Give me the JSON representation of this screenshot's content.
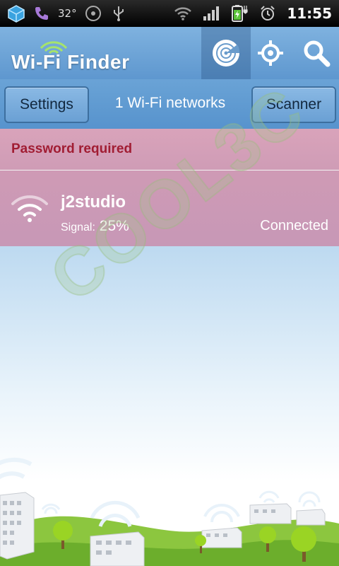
{
  "status_bar": {
    "temperature": "32°",
    "time": "11:55",
    "icons": [
      "cube-app-icon",
      "phone-icon",
      "media-icon",
      "usb-icon",
      "wifi-signal-icon",
      "cell-signal-icon",
      "battery-charging-icon",
      "alarm-icon"
    ]
  },
  "app": {
    "title": "Wi-Fi Finder",
    "header_actions": [
      "radar-icon",
      "locate-icon",
      "search-icon"
    ]
  },
  "toolbar": {
    "settings_label": "Settings",
    "network_count": "1 Wi-Fi networks",
    "scanner_label": "Scanner"
  },
  "networks": {
    "section_title": "Password required",
    "items": [
      {
        "ssid": "j2studio",
        "signal_label": "Signal:",
        "signal_value": "25%",
        "status": "Connected"
      }
    ]
  },
  "watermark": "COOL3C",
  "colors": {
    "header_blue": "#6aa3d6",
    "section_pink": "#cf9cb6",
    "password_red": "#a11d33"
  }
}
